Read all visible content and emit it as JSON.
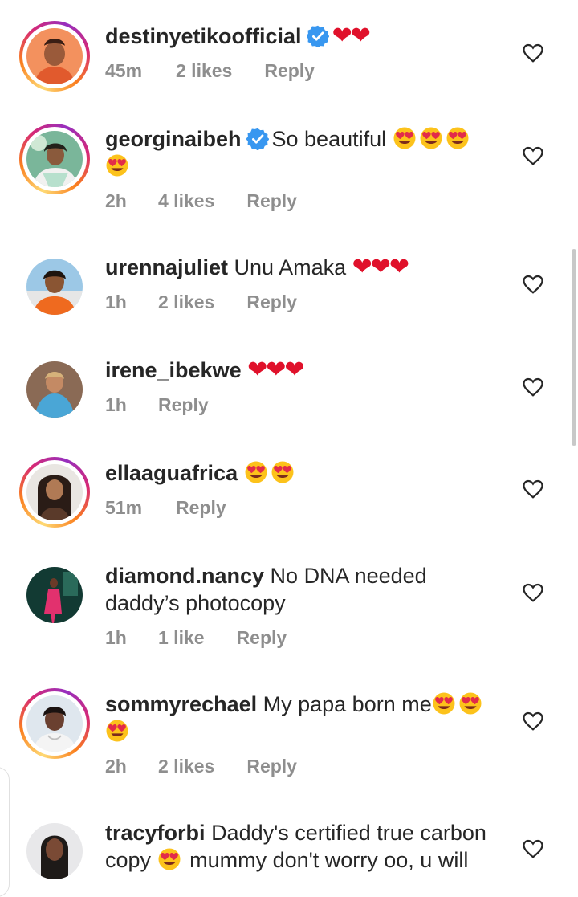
{
  "comments": [
    {
      "username": "destinyetikoofficial",
      "verified": true,
      "text": "",
      "emoji": "❤❤",
      "time": "45m",
      "likes": "2 likes",
      "reply": "Reply",
      "story_ring": true
    },
    {
      "username": "georginaibeh",
      "verified": true,
      "text": "So beautiful",
      "emoji": "😍😍😍😍",
      "time": "2h",
      "likes": "4 likes",
      "reply": "Reply",
      "story_ring": true
    },
    {
      "username": "urennajuliet",
      "verified": false,
      "text": "Unu Amaka",
      "emoji": "❤❤❤",
      "time": "1h",
      "likes": "2 likes",
      "reply": "Reply",
      "story_ring": false
    },
    {
      "username": "irene_ibekwe",
      "verified": false,
      "text": "",
      "emoji": "❤❤❤",
      "time": "1h",
      "likes": "",
      "reply": "Reply",
      "story_ring": false
    },
    {
      "username": "ellaaguafrica",
      "verified": false,
      "text": "",
      "emoji": "😍😍",
      "time": "51m",
      "likes": "",
      "reply": "Reply",
      "story_ring": true
    },
    {
      "username": "diamond.nancy",
      "verified": false,
      "text": "No DNA needed",
      "text2": "daddy’s photocopy",
      "emoji": "",
      "time": "1h",
      "likes": "1 like",
      "reply": "Reply",
      "story_ring": false
    },
    {
      "username": "sommyrechael",
      "verified": false,
      "text": "My papa born me",
      "emoji": "😍😍😍",
      "time": "2h",
      "likes": "2 likes",
      "reply": "Reply",
      "story_ring": true
    },
    {
      "username": "tracyforbi",
      "verified": false,
      "text": "Daddy's certified true carbon",
      "text2a": "copy",
      "text2b": "mummy don't worry oo, u will",
      "emoji": "😍",
      "story_ring": false
    }
  ],
  "colors": {
    "text": "#262626",
    "meta": "#8e8e8e",
    "heart": "#e0112b",
    "verified": "#3897f0"
  },
  "icons": {
    "verified": "verified-badge-icon",
    "like": "heart-outline-icon",
    "love": "heart-eyes-emoji"
  }
}
